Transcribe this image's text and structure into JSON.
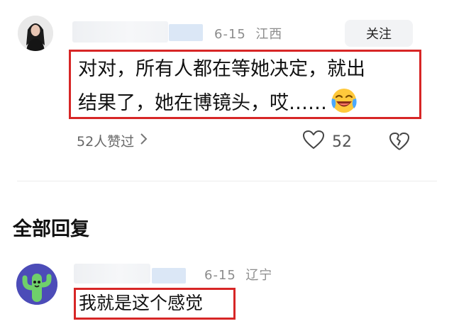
{
  "comment": {
    "date": "6-15",
    "location": "江西",
    "follow_label": "关注",
    "text_line1": "对对，所有人都在等她决定，就出",
    "text_line2": "结果了，她在博镜头，哎……",
    "emoji": "laughing-crying-emoji",
    "likers_text": "52人赞过",
    "like_count": "52"
  },
  "replies": {
    "section_title": "全部回复",
    "items": [
      {
        "date": "6-15",
        "location": "辽宁",
        "text": "我就是这个感觉"
      }
    ]
  },
  "colors": {
    "highlight": "#d72626",
    "meta_gray": "#8c8c8c",
    "button_bg": "#f2f3f5"
  }
}
